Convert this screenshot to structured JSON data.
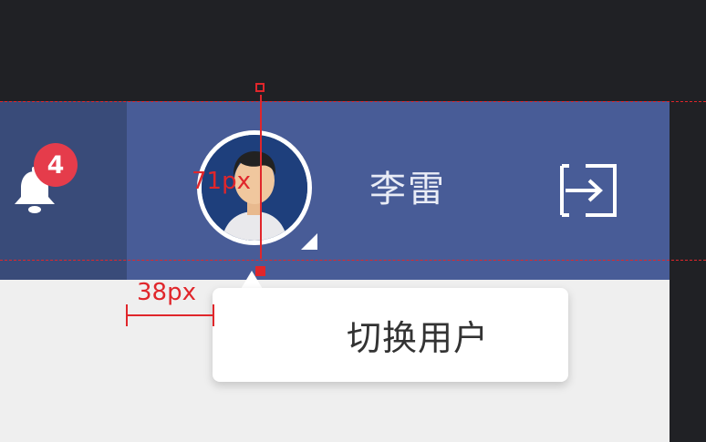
{
  "notifications": {
    "badge_count": "4",
    "icon": "bell-icon"
  },
  "user": {
    "name": "李雷",
    "avatar_icon": "user-avatar",
    "logout_icon": "logout-icon"
  },
  "tooltip": {
    "text": "切换用户"
  },
  "annotations": {
    "vertical_measure": "71px",
    "horizontal_measure": "38px"
  },
  "colors": {
    "background_dark": "#202125",
    "header_bell_section": "#394b79",
    "header_user_section": "#485c97",
    "badge": "#e53c4b",
    "content_bg": "#efefef",
    "annotation_red": "#e0262b"
  }
}
